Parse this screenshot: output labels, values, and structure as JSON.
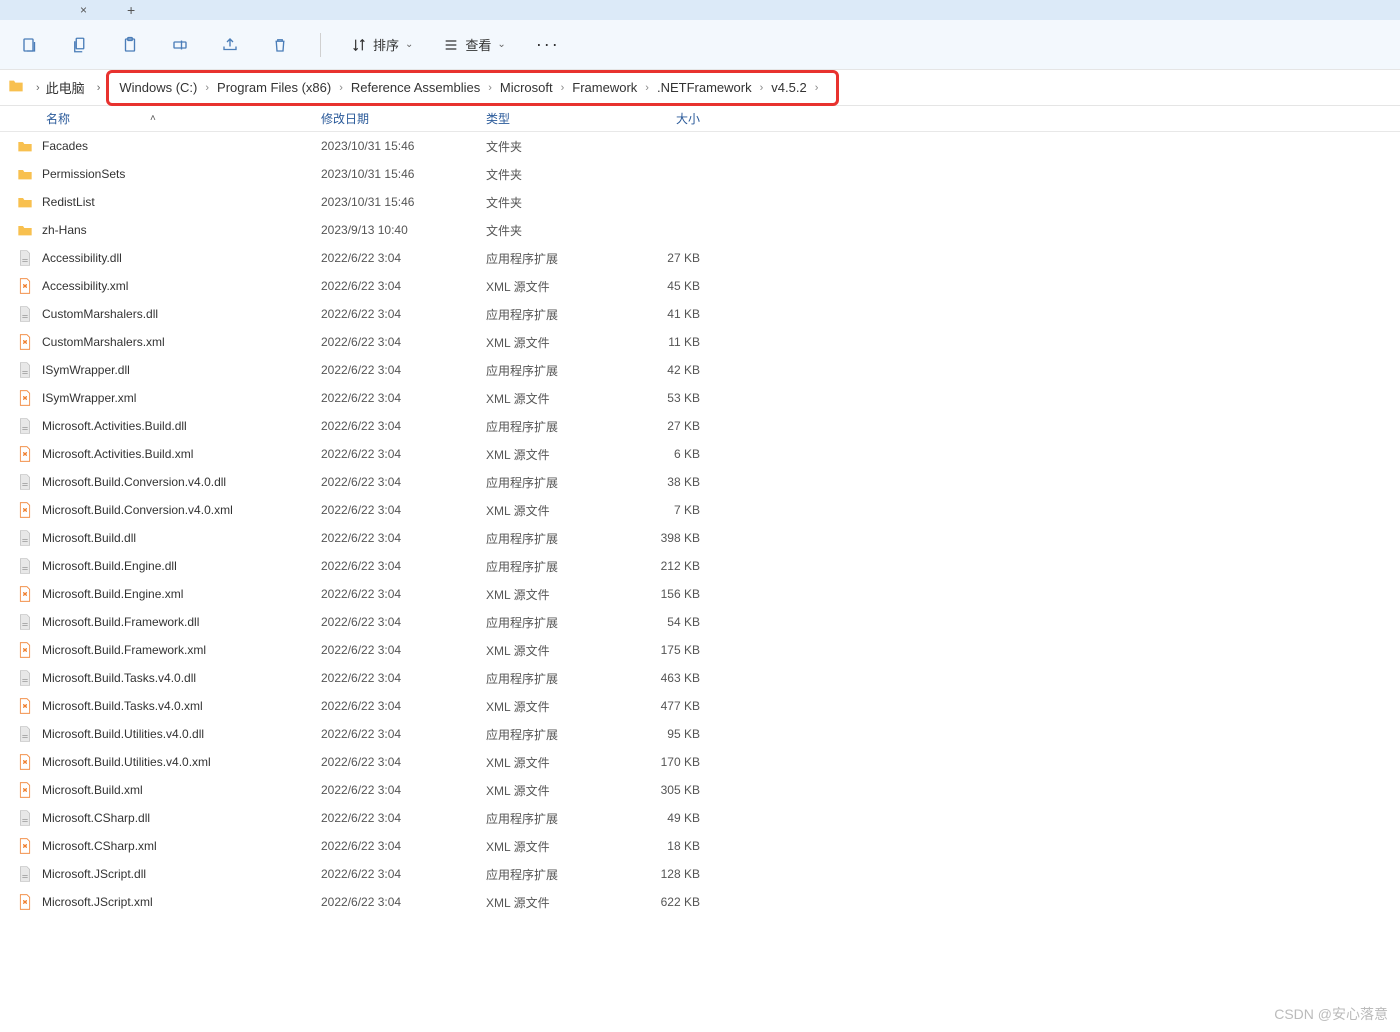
{
  "tabs": {
    "close_title": "×",
    "add_title": "+"
  },
  "toolbar": {
    "sort_label": "排序",
    "view_label": "查看"
  },
  "breadcrumb": {
    "root": "此电脑",
    "items": [
      "Windows (C:)",
      "Program Files (x86)",
      "Reference Assemblies",
      "Microsoft",
      "Framework",
      ".NETFramework",
      "v4.5.2"
    ]
  },
  "headers": {
    "name": "名称",
    "date": "修改日期",
    "type": "类型",
    "size": "大小"
  },
  "types": {
    "folder": "文件夹",
    "dll": "应用程序扩展",
    "xml": "XML 源文件"
  },
  "files": [
    {
      "icon": "folder",
      "name": "Facades",
      "date": "2023/10/31 15:46",
      "type_key": "folder",
      "size": ""
    },
    {
      "icon": "folder",
      "name": "PermissionSets",
      "date": "2023/10/31 15:46",
      "type_key": "folder",
      "size": ""
    },
    {
      "icon": "folder",
      "name": "RedistList",
      "date": "2023/10/31 15:46",
      "type_key": "folder",
      "size": ""
    },
    {
      "icon": "folder",
      "name": "zh-Hans",
      "date": "2023/9/13 10:40",
      "type_key": "folder",
      "size": ""
    },
    {
      "icon": "dll",
      "name": "Accessibility.dll",
      "date": "2022/6/22 3:04",
      "type_key": "dll",
      "size": "27 KB"
    },
    {
      "icon": "xml",
      "name": "Accessibility.xml",
      "date": "2022/6/22 3:04",
      "type_key": "xml",
      "size": "45 KB"
    },
    {
      "icon": "dll",
      "name": "CustomMarshalers.dll",
      "date": "2022/6/22 3:04",
      "type_key": "dll",
      "size": "41 KB"
    },
    {
      "icon": "xml",
      "name": "CustomMarshalers.xml",
      "date": "2022/6/22 3:04",
      "type_key": "xml",
      "size": "11 KB"
    },
    {
      "icon": "dll",
      "name": "ISymWrapper.dll",
      "date": "2022/6/22 3:04",
      "type_key": "dll",
      "size": "42 KB"
    },
    {
      "icon": "xml",
      "name": "ISymWrapper.xml",
      "date": "2022/6/22 3:04",
      "type_key": "xml",
      "size": "53 KB"
    },
    {
      "icon": "dll",
      "name": "Microsoft.Activities.Build.dll",
      "date": "2022/6/22 3:04",
      "type_key": "dll",
      "size": "27 KB"
    },
    {
      "icon": "xml",
      "name": "Microsoft.Activities.Build.xml",
      "date": "2022/6/22 3:04",
      "type_key": "xml",
      "size": "6 KB"
    },
    {
      "icon": "dll",
      "name": "Microsoft.Build.Conversion.v4.0.dll",
      "date": "2022/6/22 3:04",
      "type_key": "dll",
      "size": "38 KB"
    },
    {
      "icon": "xml",
      "name": "Microsoft.Build.Conversion.v4.0.xml",
      "date": "2022/6/22 3:04",
      "type_key": "xml",
      "size": "7 KB"
    },
    {
      "icon": "dll",
      "name": "Microsoft.Build.dll",
      "date": "2022/6/22 3:04",
      "type_key": "dll",
      "size": "398 KB"
    },
    {
      "icon": "dll",
      "name": "Microsoft.Build.Engine.dll",
      "date": "2022/6/22 3:04",
      "type_key": "dll",
      "size": "212 KB"
    },
    {
      "icon": "xml",
      "name": "Microsoft.Build.Engine.xml",
      "date": "2022/6/22 3:04",
      "type_key": "xml",
      "size": "156 KB"
    },
    {
      "icon": "dll",
      "name": "Microsoft.Build.Framework.dll",
      "date": "2022/6/22 3:04",
      "type_key": "dll",
      "size": "54 KB"
    },
    {
      "icon": "xml",
      "name": "Microsoft.Build.Framework.xml",
      "date": "2022/6/22 3:04",
      "type_key": "xml",
      "size": "175 KB"
    },
    {
      "icon": "dll",
      "name": "Microsoft.Build.Tasks.v4.0.dll",
      "date": "2022/6/22 3:04",
      "type_key": "dll",
      "size": "463 KB"
    },
    {
      "icon": "xml",
      "name": "Microsoft.Build.Tasks.v4.0.xml",
      "date": "2022/6/22 3:04",
      "type_key": "xml",
      "size": "477 KB"
    },
    {
      "icon": "dll",
      "name": "Microsoft.Build.Utilities.v4.0.dll",
      "date": "2022/6/22 3:04",
      "type_key": "dll",
      "size": "95 KB"
    },
    {
      "icon": "xml",
      "name": "Microsoft.Build.Utilities.v4.0.xml",
      "date": "2022/6/22 3:04",
      "type_key": "xml",
      "size": "170 KB"
    },
    {
      "icon": "xml",
      "name": "Microsoft.Build.xml",
      "date": "2022/6/22 3:04",
      "type_key": "xml",
      "size": "305 KB"
    },
    {
      "icon": "dll",
      "name": "Microsoft.CSharp.dll",
      "date": "2022/6/22 3:04",
      "type_key": "dll",
      "size": "49 KB"
    },
    {
      "icon": "xml",
      "name": "Microsoft.CSharp.xml",
      "date": "2022/6/22 3:04",
      "type_key": "xml",
      "size": "18 KB"
    },
    {
      "icon": "dll",
      "name": "Microsoft.JScript.dll",
      "date": "2022/6/22 3:04",
      "type_key": "dll",
      "size": "128 KB"
    },
    {
      "icon": "xml",
      "name": "Microsoft.JScript.xml",
      "date": "2022/6/22 3:04",
      "type_key": "xml",
      "size": "622 KB"
    }
  ],
  "watermark": "CSDN @安心落意"
}
